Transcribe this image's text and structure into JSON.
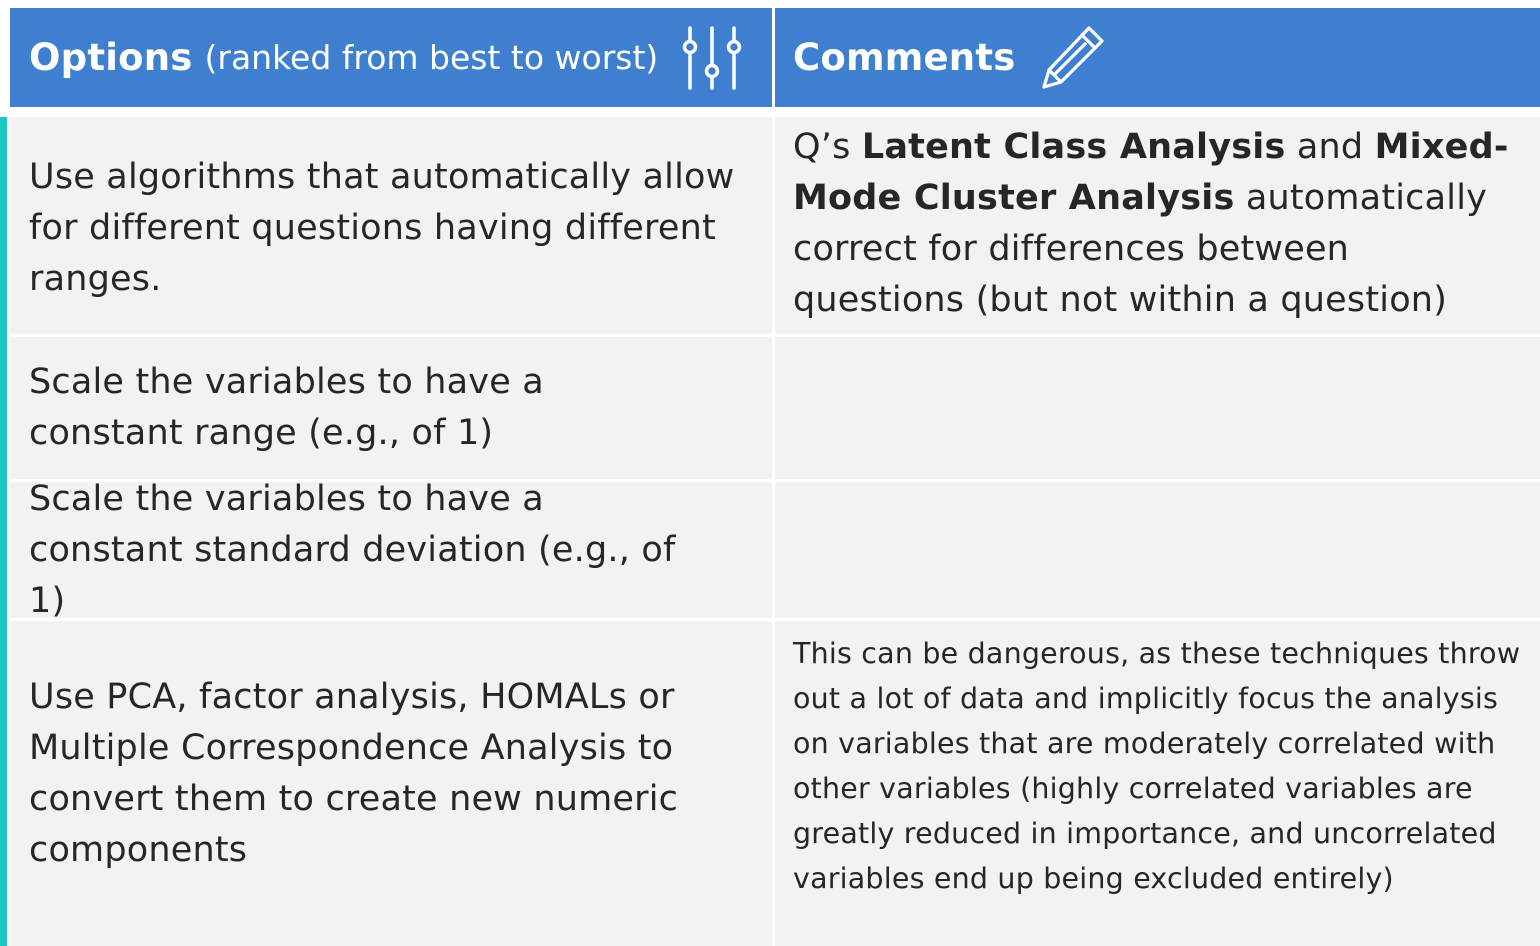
{
  "header": {
    "options_title": "Options",
    "options_subtitle": "(ranked from best to worst)",
    "options_icon": "sliders-icon",
    "comments_title": "Comments",
    "comments_icon": "pencil-icon"
  },
  "rows": [
    {
      "option": "Use algorithms that automatically allow for different questions having different ranges.",
      "comment": {
        "p1": "Q’s ",
        "b1": "Latent Class Analysis",
        "p2": " and ",
        "b2": "Mixed-Mode Cluster Analysis",
        "p3": " automatically correct for differences between questions (but not within a question)"
      }
    },
    {
      "option": "Scale the variables to have a constant range (e.g., of 1)",
      "comment": ""
    },
    {
      "option": "Scale the variables to have a constant standard deviation (e.g., of 1)",
      "comment": ""
    },
    {
      "option": "Use PCA, factor analysis, HOMALs or Multiple Correspondence Analysis to convert them to create new numeric components",
      "comment": "This can be dangerous, as these techniques throw out a lot of data and implicitly focus the analysis on variables that are moderately correlated with other variables (highly correlated variables are greatly reduced in importance, and uncorrelated variables end up being excluded entirely)"
    }
  ],
  "colors": {
    "header_bg": "#3f7fcf",
    "cell_bg": "#f2f2f2",
    "accent": "#1cc8c0",
    "text": "#262626"
  }
}
